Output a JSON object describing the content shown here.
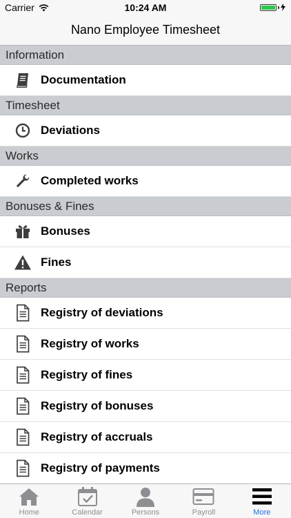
{
  "status_bar": {
    "carrier": "Carrier",
    "time": "10:24 AM"
  },
  "nav": {
    "title": "Nano Employee Timesheet"
  },
  "sections": [
    {
      "header": "Information",
      "items": [
        {
          "label": "Documentation",
          "icon": "book-icon"
        }
      ]
    },
    {
      "header": "Timesheet",
      "items": [
        {
          "label": "Deviations",
          "icon": "clock-icon"
        }
      ]
    },
    {
      "header": "Works",
      "items": [
        {
          "label": "Completed works",
          "icon": "wrench-icon"
        }
      ]
    },
    {
      "header": "Bonuses & Fines",
      "items": [
        {
          "label": "Bonuses",
          "icon": "gift-icon"
        },
        {
          "label": "Fines",
          "icon": "warning-icon"
        }
      ]
    },
    {
      "header": "Reports",
      "items": [
        {
          "label": "Registry of deviations",
          "icon": "document-icon"
        },
        {
          "label": "Registry of works",
          "icon": "document-icon"
        },
        {
          "label": "Registry of fines",
          "icon": "document-icon"
        },
        {
          "label": "Registry of bonuses",
          "icon": "document-icon"
        },
        {
          "label": "Registry of  accruals",
          "icon": "document-icon"
        },
        {
          "label": "Registry of payments",
          "icon": "document-icon"
        }
      ]
    }
  ],
  "tab_bar": [
    {
      "label": "Home",
      "icon": "home-icon",
      "active": false
    },
    {
      "label": "Calendar",
      "icon": "calendar-icon",
      "active": false
    },
    {
      "label": "Persons",
      "icon": "person-icon",
      "active": false
    },
    {
      "label": "Payroll",
      "icon": "card-icon",
      "active": false
    },
    {
      "label": "More",
      "icon": "menu-icon",
      "active": true
    }
  ],
  "colors": {
    "section_bg": "#c9ccd0",
    "active_tab": "#1c6ee0",
    "inactive_tab": "#8e8e93",
    "battery": "#2ec84c"
  }
}
